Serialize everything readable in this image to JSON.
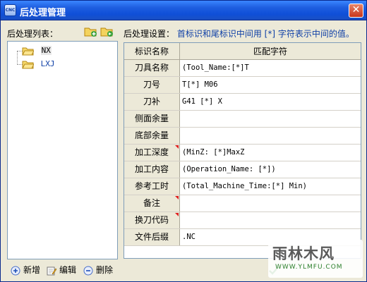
{
  "window": {
    "title": "后处理管理",
    "app_icon_text": "CNC",
    "close_icon": "close-icon"
  },
  "left_panel": {
    "header": "后处理列表：",
    "toolbar_icons": [
      "add-folder-icon",
      "copy-folder-icon"
    ],
    "tree": [
      {
        "label": "NX",
        "selected": true
      },
      {
        "label": "LXJ",
        "selected": false
      }
    ]
  },
  "right_panel": {
    "header_label": "后处理设置：",
    "header_hint": "首标识和尾标识中间用 [*] 字符表示中间的值。",
    "columns": [
      "标识名称",
      "匹配字符"
    ],
    "rows": [
      {
        "name": "刀具名称",
        "value": "(Tool_Name:[*]T",
        "marked": false
      },
      {
        "name": "刀号",
        "value": "T[*] M06",
        "marked": false
      },
      {
        "name": "刀补",
        "value": "G41 [*] X",
        "marked": false
      },
      {
        "name": "侧面余量",
        "value": "",
        "marked": false
      },
      {
        "name": "底部余量",
        "value": "",
        "marked": false
      },
      {
        "name": "加工深度",
        "value": "(MinZ: [*]MaxZ",
        "marked": true
      },
      {
        "name": "加工内容",
        "value": "(Operation_Name: [*])",
        "marked": false
      },
      {
        "name": "参考工时",
        "value": "(Total_Machine_Time:[*] Min)",
        "marked": false
      },
      {
        "name": "备注",
        "value": "",
        "marked": true
      },
      {
        "name": "换刀代码",
        "value": "",
        "marked": true
      },
      {
        "name": "文件后缀",
        "value": ".NC",
        "marked": false
      }
    ]
  },
  "bottom_bar": {
    "add_label": "新增",
    "edit_label": "编辑",
    "delete_label": "删除"
  },
  "watermark": {
    "title": "雨林木风",
    "url": "WWW.YLMFU.COM"
  },
  "colors": {
    "titlebar": "#0f4fd8",
    "panel_bg": "#ece9d8",
    "hint": "#0e3fa6",
    "marker": "#e02020"
  }
}
